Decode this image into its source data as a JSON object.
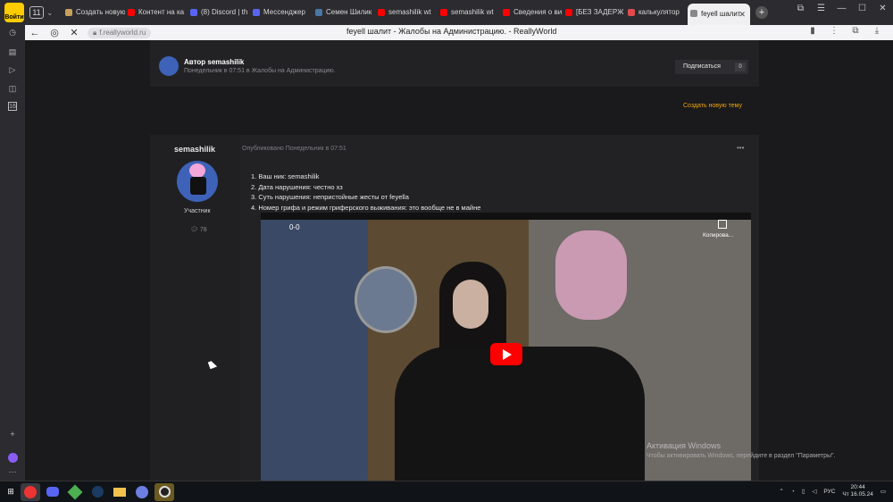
{
  "browser": {
    "badge": "Войти",
    "tab_count": "11",
    "tabs": [
      {
        "label": "Создать новую",
        "color": "#c7a15a"
      },
      {
        "label": "Контент на ка",
        "color": "#ff0000"
      },
      {
        "label": "(8) Discord | th",
        "color": "#5865f2"
      },
      {
        "label": "Мессенджер",
        "color": "#5865f2"
      },
      {
        "label": "Семен Шилик",
        "color": "#4a76a8"
      },
      {
        "label": "semashilik wt",
        "color": "#ff0000"
      },
      {
        "label": "semashilik wt",
        "color": "#ff0000"
      },
      {
        "label": "Сведения о ви",
        "color": "#ff0000"
      },
      {
        "label": "[БЕЗ ЗАДЕРЖ",
        "color": "#ff0000"
      },
      {
        "label": "калькулятор",
        "color": "#e24b4b"
      }
    ],
    "active_tab": "feyell шалит",
    "url": "f.reallyworld.ru",
    "page_title": "feyell шалит - Жалобы на Администрацию. - ReallyWorld"
  },
  "sidebar": {
    "badge_16": "16"
  },
  "topic": {
    "author_label": "Автор semashilik",
    "author_meta": "Понедельник в 07:51 в Жалобы на Администрацию.",
    "follow_label": "Подписаться",
    "follow_count": "0",
    "create_topic": "Создать новую тему"
  },
  "post": {
    "author": "semashilik",
    "role": "Участник",
    "post_count": "78",
    "published": "Опубликовано Понедельник в 07:51",
    "menu": "•••",
    "lines": [
      "1. Ваш ник: semashilik",
      "2. Дата нарушения: честно хз",
      "3. Суть нарушения: непристойные жесты от feyella",
      "4. Номер грифа и режим гриферского выживания: это вообще не в майне"
    ]
  },
  "video": {
    "title": "0-0",
    "copy_label": "Копирова..."
  },
  "watermark": {
    "title": "Активация Windows",
    "subtitle": "Чтобы активировать Windows, перейдите в раздел \"Параметры\"."
  },
  "taskbar": {
    "lang": "РУС",
    "time": "20:44",
    "date": "Чт 16.05.24"
  }
}
